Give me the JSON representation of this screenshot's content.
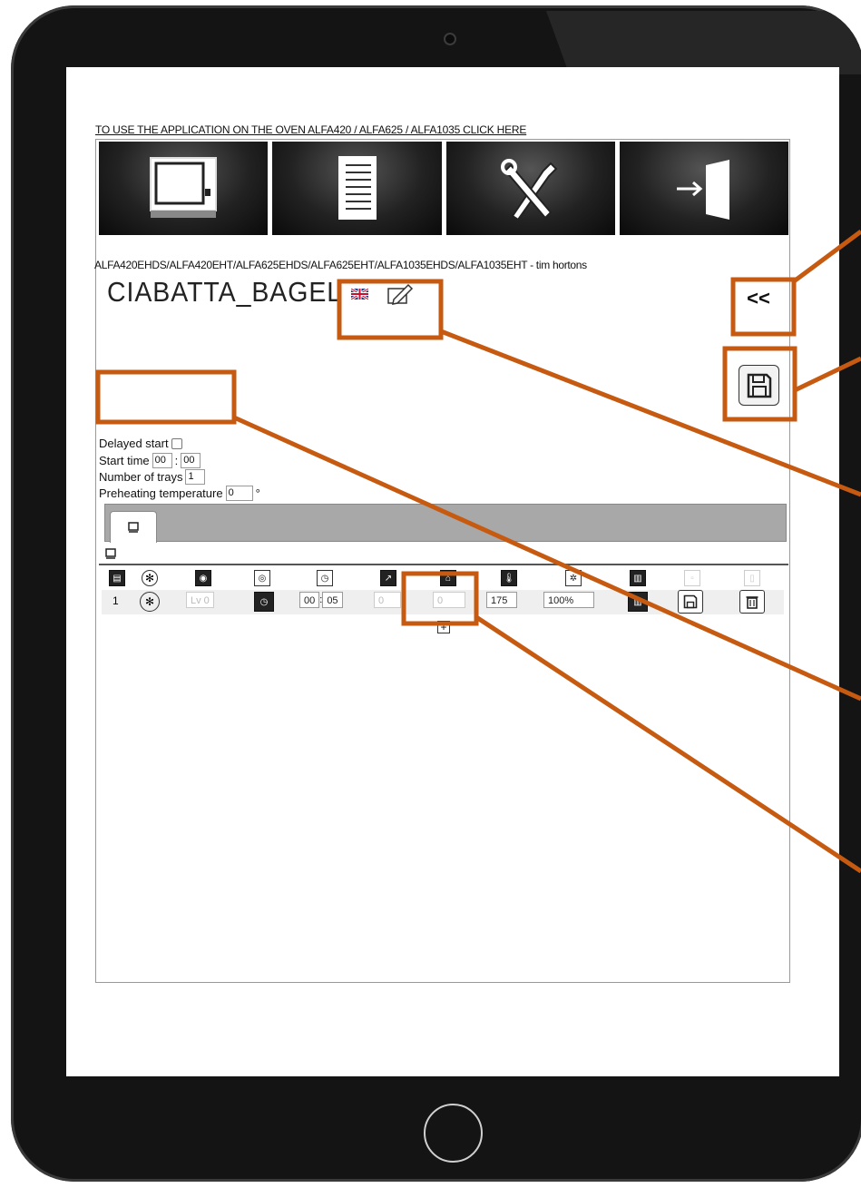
{
  "app": {
    "top_link": "TO USE THE APPLICATION ON THE OVEN ALFA420 / ALFA625 / ALFA1035 CLICK HERE",
    "tiles": [
      {
        "icon": "oven-icon"
      },
      {
        "icon": "notebook-icon"
      },
      {
        "icon": "tools-icon"
      },
      {
        "icon": "exit-icon"
      }
    ],
    "model_line": "ALFA420EHDS/ALFA420EHT/ALFA625EHDS/ALFA625EHT/ALFA1035EHDS/ALFA1035EHT - tim hortons",
    "recipe_name": "CIABATTA_BAGEL",
    "collapse_label": "<<",
    "form": {
      "delayed_start_label": "Delayed start",
      "start_time_label": "Start time",
      "start_hour": "00",
      "start_minute": "00",
      "trays_label": "Number of trays",
      "trays_value": "1",
      "preheat_label": "Preheating temperature",
      "preheat_value": "0",
      "degree_symbol": "°"
    },
    "step": {
      "number": "1",
      "level": "Lv 0",
      "time_minutes": "00",
      "time_seconds": "05",
      "humidity": "0",
      "venting": "0",
      "temperature": "175",
      "fan_speed": "100%"
    },
    "plus_label": "+"
  },
  "colors": {
    "callout": "#c65a11",
    "tab_bar": "#a8a8a8",
    "bezel": "#141414"
  }
}
